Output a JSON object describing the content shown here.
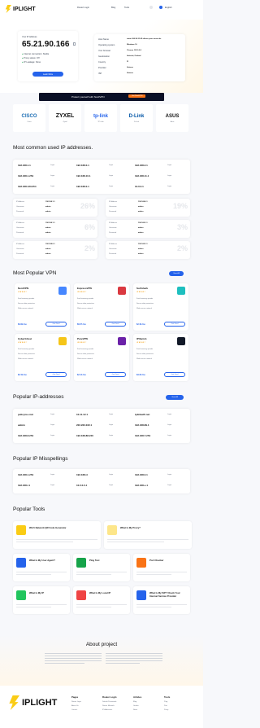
{
  "header": {
    "brand": "IPLIGHT",
    "nav": [
      "Router Login",
      "Blog",
      "Tools"
    ],
    "language": "English"
  },
  "hero": {
    "ip_label": "Your IP Address",
    "ip": "65.21.90.166",
    "statuses": [
      "Internet connection: Stable",
      "Proxy status: Off",
      "IP Leakage: None"
    ],
    "button": "Learn More",
    "details": [
      [
        "Host Name",
        "static.166.90.21.65.clients.your-server.de"
      ],
      [
        "Operating system",
        "Windows 10"
      ],
      [
        "Your browser",
        "Chrome 122.0.0.0"
      ],
      [
        "Geolocation",
        "Helsinki, Finland"
      ],
      [
        "Country",
        "FI"
      ],
      [
        "Provider",
        "Hetzner"
      ],
      [
        "ISP",
        "Hetzner"
      ]
    ]
  },
  "vpn_banner": {
    "text": "Protect yourself with NordVPN",
    "cta": "Get NordVPN"
  },
  "brands": [
    {
      "name": "CISCO",
      "label": "Cisco"
    },
    {
      "name": "ZYXEL",
      "label": "Zyxel"
    },
    {
      "name": "tp-link",
      "label": "TP-Link"
    },
    {
      "name": "D-Link",
      "label": "D-Link"
    },
    {
      "name": "ASUS",
      "label": "Asus"
    }
  ],
  "common_ips": {
    "title": "Most common used IP addresses.",
    "rows": [
      [
        "192.168.1.1",
        "Login",
        "192.168.0.1",
        "Login",
        "192.168.2.1",
        "Login"
      ],
      [
        "192.168.1.254",
        "Login",
        "192.168.10.1",
        "Login",
        "192.168.11.1",
        "Login"
      ],
      [
        "192.168.123.254",
        "Login",
        "192.168.0.1",
        "Login",
        "10.0.0.1",
        "Login"
      ]
    ]
  },
  "creds": [
    {
      "pct": "26%",
      "rows": [
        [
          "IP Address",
          "192.168.1.1"
        ],
        [
          "Username",
          "admin"
        ],
        [
          "Password",
          "admin"
        ]
      ]
    },
    {
      "pct": "19%",
      "rows": [
        [
          "IP Address",
          "192.168.0.1"
        ],
        [
          "Username",
          "admin"
        ],
        [
          "Password",
          "admin"
        ]
      ]
    },
    {
      "pct": "6%",
      "rows": [
        [
          "IP Address",
          "192.168.1.1"
        ],
        [
          "Username",
          "admin"
        ],
        [
          "Password",
          "admin"
        ]
      ]
    },
    {
      "pct": "3%",
      "rows": [
        [
          "IP Address",
          "192.168.1.1"
        ],
        [
          "Username",
          "admin"
        ],
        [
          "Password",
          "admin"
        ]
      ]
    },
    {
      "pct": "2%",
      "rows": [
        [
          "IP Address",
          "192.168.0.1"
        ],
        [
          "Username",
          "admin"
        ],
        [
          "Password",
          "admin"
        ]
      ]
    },
    {
      "pct": "2%",
      "rows": [
        [
          "IP Address",
          "192.168.1.1"
        ],
        [
          "Username",
          "admin"
        ],
        [
          "Password",
          "admin"
        ]
      ]
    }
  ],
  "vpn": {
    "title": "Most Popular VPN",
    "view_all": "View All",
    "items": [
      {
        "name": "NordVPN",
        "price": "$3.99 /mo",
        "btn": "Get Deal",
        "color": "#4687ff"
      },
      {
        "name": "ExpressVPN",
        "price": "$6.67 /mo",
        "btn": "Get Deal",
        "color": "#da3940"
      },
      {
        "name": "Surfshark",
        "price": "$2.49 /mo",
        "btn": "Get Deal",
        "color": "#1ebfbf"
      },
      {
        "name": "CyberGhost",
        "price": "$2.19 /mo",
        "btn": "Get Deal",
        "color": "#f5c518"
      },
      {
        "name": "PureVPN",
        "price": "$2.14 /mo",
        "btn": "Get Deal",
        "color": "#6b21a8"
      },
      {
        "name": "IPVanish",
        "price": "$3.33 /mo",
        "btn": "Get Deal",
        "color": "#111827"
      }
    ],
    "bullets": [
      "Fast browsing speeds",
      "Secure data protection",
      "Wide server network"
    ]
  },
  "popular_ips": {
    "title": "Popular IP-addresses",
    "btn": "View All",
    "rows": [
      [
        "pelicyou.com",
        "Login",
        "10.11.12.1",
        "Login",
        "tplinkwifi.net",
        "Login"
      ],
      [
        "admin",
        "Login",
        "222.222.222.1",
        "Login",
        "192.168.89.1",
        "Login"
      ],
      [
        "192.168.8.254",
        "Login",
        "192.168.88.240",
        "Login",
        "192.168.7.254",
        "Login"
      ]
    ]
  },
  "misspell": {
    "title": "Popular IP Misspellings",
    "rows": [
      [
        "192.168.1.254",
        "Login",
        "192.168.l.l",
        "Login",
        "192.168.0.1",
        "Login"
      ],
      [
        "192.168.l.1",
        "Login",
        "10.0.0.0.1",
        "Login",
        "192.168.o.1",
        "Login"
      ]
    ]
  },
  "tools": {
    "title": "Popular Tools",
    "items": [
      {
        "name": "Wi-Fi Network QR Code Generator",
        "c": "#facc15"
      },
      {
        "name": "What Is My Proxy?",
        "c": "#fde68a"
      },
      {
        "name": "What Is My User Agent?",
        "c": "#2563eb"
      },
      {
        "name": "Ping Test",
        "c": "#16a34a"
      },
      {
        "name": "Port Checker",
        "c": "#f97316"
      },
      {
        "name": "What Is My IP",
        "c": "#22c55e"
      },
      {
        "name": "What Is My Local IP",
        "c": "#ef4444"
      },
      {
        "name": "What Is My ISP? Check Your Internet Service Provider",
        "c": "#2563eb"
      }
    ]
  },
  "about": {
    "title": "About project"
  },
  "footer": {
    "brand": "IPLIGHT",
    "cols": [
      {
        "h": "Pages",
        "l": [
          "Router Login",
          "About Us",
          "Contact"
        ]
      },
      {
        "h": "Router Login",
        "l": [
          "Default Passwords",
          "Router Manuals",
          "IP Addresses"
        ]
      },
      {
        "h": "Articles",
        "l": [
          "Blog",
          "Guides",
          "News"
        ]
      },
      {
        "h": "Tools",
        "l": [
          "Ping",
          "Port",
          "Proxy"
        ]
      }
    ]
  }
}
